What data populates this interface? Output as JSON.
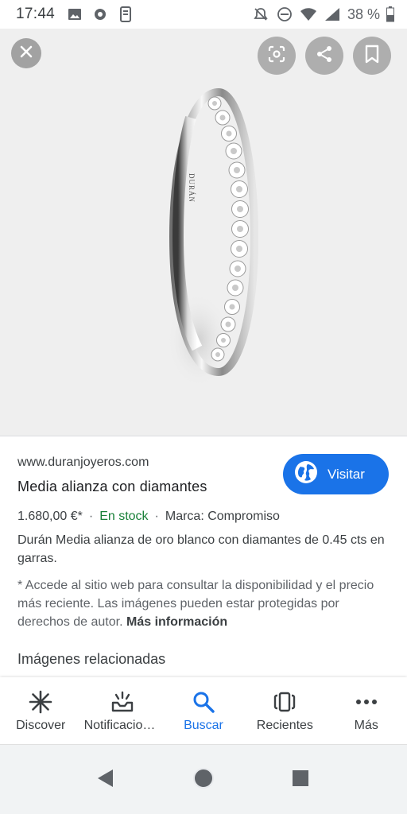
{
  "status_bar": {
    "time": "17:44",
    "battery": "38 %"
  },
  "viewer": {
    "image_alt": "Media alianza con diamantes",
    "engraving": "DURÁN",
    "buttons": {
      "close": "close-icon",
      "lens": "lens-icon",
      "share": "share-icon",
      "save": "bookmark-icon"
    }
  },
  "info": {
    "site": "www.duranjoyeros.com",
    "title": "Media alianza con diamantes",
    "visit_label": "Visitar",
    "price": "1.680,00 €*",
    "stock": "En stock",
    "brand": "Marca: Compromiso",
    "separator": "·",
    "description": "Durán Media alianza de oro blanco con diamantes de 0.45 cts en garras.",
    "disclaimer": "* Accede al sitio web para consultar la disponibilidad y el precio más reciente. Las imágenes pueden estar protegidas por derechos de autor.",
    "more_info": "Más información",
    "related_title": "Imágenes relacionadas"
  },
  "bottom_nav": {
    "items": [
      {
        "label": "Discover",
        "icon": "asterisk-icon"
      },
      {
        "label": "Notificaciones",
        "icon": "notifications-icon"
      },
      {
        "label": "Buscar",
        "icon": "search-icon"
      },
      {
        "label": "Recientes",
        "icon": "recents-icon"
      },
      {
        "label": "Más",
        "icon": "more-icon"
      }
    ],
    "active": "Buscar"
  },
  "colors": {
    "accent": "#1a73e8",
    "stock": "#188038"
  }
}
